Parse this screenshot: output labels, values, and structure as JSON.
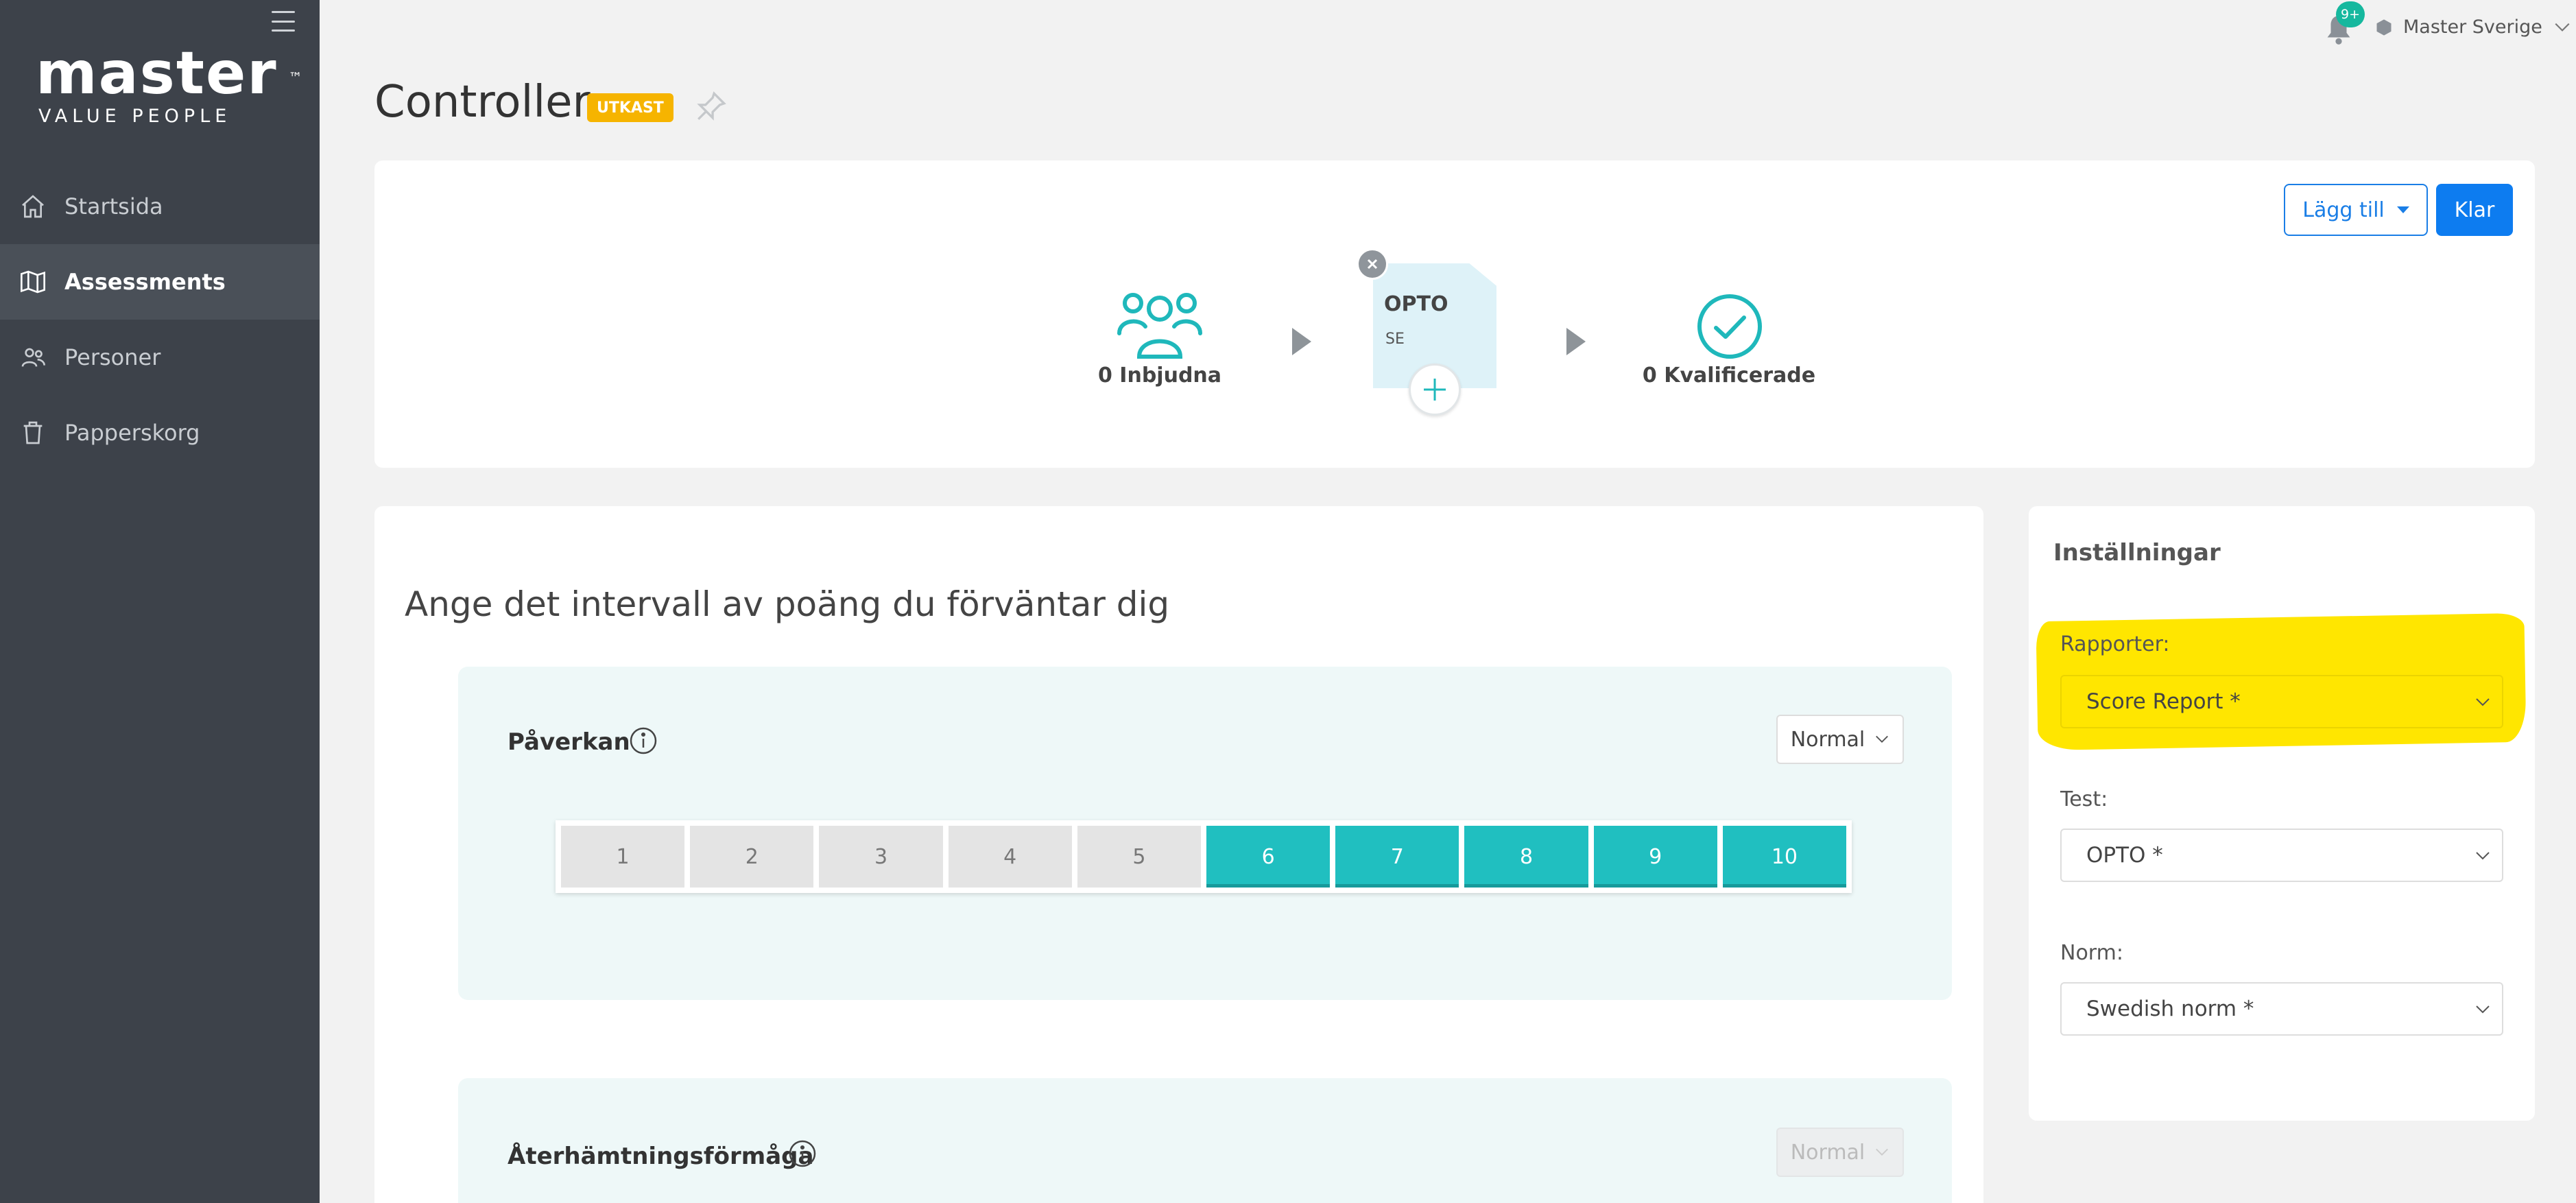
{
  "sidebar": {
    "logo_main": "master",
    "logo_tm": "™",
    "logo_sub": "VALUE PEOPLE",
    "items": [
      {
        "label": "Startsida",
        "icon": "home-icon"
      },
      {
        "label": "Assessments",
        "icon": "map-icon",
        "active": true
      },
      {
        "label": "Personer",
        "icon": "users-icon"
      },
      {
        "label": "Papperskorg",
        "icon": "trash-icon"
      }
    ]
  },
  "topbar": {
    "notification_count": "9+",
    "account_name": "Master Sverige"
  },
  "header": {
    "title": "Controller",
    "status_badge": "UTKAST"
  },
  "pipeline": {
    "add_button": "Lägg till",
    "done_button": "Klar",
    "invited_label": "0 Inbjudna",
    "test_name": "OPTO",
    "test_lang": "SE",
    "qualified_label": "0 Kvalificerade"
  },
  "main": {
    "heading": "Ange det intervall av poäng du förväntar dig",
    "scales": [
      {
        "name": "Påverkan",
        "norm": "Normal",
        "values": [
          1,
          2,
          3,
          4,
          5,
          6,
          7,
          8,
          9,
          10
        ],
        "selected_from": 6,
        "selected_to": 10
      },
      {
        "name": "Återhämtningsförmåga",
        "norm": "Normal"
      }
    ]
  },
  "settings": {
    "title": "Inställningar",
    "reports_label": "Rapporter:",
    "reports_value": "Score Report *",
    "test_label": "Test:",
    "test_value": "OPTO *",
    "norm_label": "Norm:",
    "norm_value": "Swedish norm *"
  },
  "colors": {
    "sidebar_bg": "#3d424a",
    "accent_teal": "#20bfc0",
    "primary_blue": "#0d7cf0",
    "draft_orange": "#f6b400",
    "highlight_yellow": "#ffe600"
  }
}
